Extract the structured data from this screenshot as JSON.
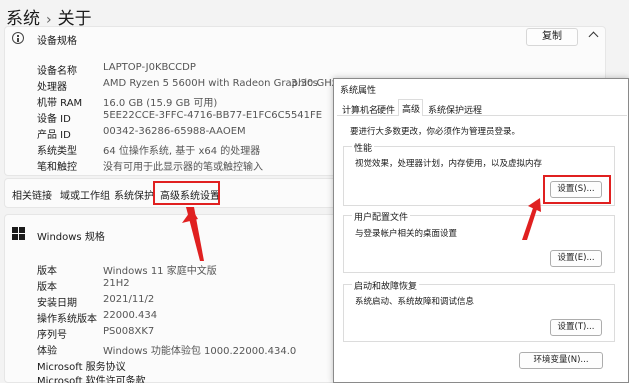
{
  "breadcrumb": {
    "parent": "系统",
    "separator": "›",
    "current": "关于"
  },
  "device_spec": {
    "title": "设备规格",
    "copy_button": "复制",
    "rows": [
      {
        "label": "设备名称",
        "value": "LAPTOP-J0KBCCDP",
        "extra": ""
      },
      {
        "label": "处理器",
        "value": "AMD Ryzen 5 5600H with Radeon Graphics",
        "extra": "3.30 GHz"
      },
      {
        "label": "机带 RAM",
        "value": "16.0 GB (15.9 GB 可用)",
        "extra": ""
      },
      {
        "label": "设备 ID",
        "value": "5EE22CCE-3FFC-4716-BB77-E1FC6C5541FE",
        "extra": ""
      },
      {
        "label": "产品 ID",
        "value": "00342-36286-65988-AAOEM",
        "extra": ""
      },
      {
        "label": "系统类型",
        "value": "64 位操作系统, 基于 x64 的处理器",
        "extra": ""
      },
      {
        "label": "笔和触控",
        "value": "没有可用于此显示器的笔或触控输入",
        "extra": ""
      }
    ]
  },
  "related_links": {
    "items": [
      "相关链接",
      "域或工作组",
      "系统保护",
      "高级系统设置"
    ]
  },
  "windows_spec": {
    "title": "Windows 规格",
    "rows": [
      {
        "label": "版本",
        "value": "Windows 11 家庭中文版"
      },
      {
        "label": "版本",
        "value": "21H2"
      },
      {
        "label": "安装日期",
        "value": "2021/11/2"
      },
      {
        "label": "操作系统版本",
        "value": "22000.434"
      },
      {
        "label": "序列号",
        "value": "PS008XK7"
      },
      {
        "label": "体验",
        "value": "Windows 功能体验包 1000.22000.434.0"
      }
    ],
    "footer_links": [
      "Microsoft 服务协议",
      "Microsoft 软件许可条款"
    ]
  },
  "dialog": {
    "title": "系统属性",
    "tabs": [
      "计算机名",
      "硬件",
      "高级",
      "系统保护",
      "远程"
    ],
    "active_tab": "高级",
    "notice": "要进行大多数更改，你必须作为管理员登录。",
    "groups": [
      {
        "title": "性能",
        "desc": "视觉效果，处理器计划，内存使用，以及虚拟内存",
        "button": "设置(S)..."
      },
      {
        "title": "用户配置文件",
        "desc": "与登录帐户相关的桌面设置",
        "button": "设置(E)..."
      },
      {
        "title": "启动和故障恢复",
        "desc": "系统启动、系统故障和调试信息",
        "button": "设置(T)..."
      }
    ],
    "env_button": "环境变量(N)..."
  },
  "colors": {
    "highlight": "#e02020",
    "accent": "#0067c0"
  }
}
